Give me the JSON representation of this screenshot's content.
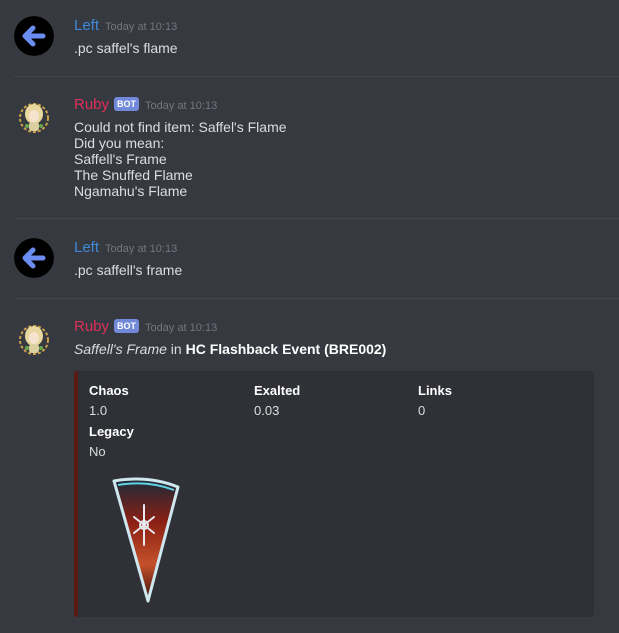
{
  "messages": [
    {
      "author": "Left",
      "timestamp": "Today at 10:13",
      "lines": [
        ".pc saffel's flame"
      ]
    },
    {
      "author": "Ruby",
      "bot_tag": "BOT",
      "timestamp": "Today at 10:13",
      "lines": [
        "Could not find item: Saffel's Flame",
        "Did you mean:",
        "Saffell's Frame",
        "The Snuffed Flame",
        "Ngamahu's Flame"
      ]
    },
    {
      "author": "Left",
      "timestamp": "Today at 10:13",
      "lines": [
        ".pc saffell's frame"
      ]
    },
    {
      "author": "Ruby",
      "bot_tag": "BOT",
      "timestamp": "Today at 10:13",
      "result": {
        "item": "Saffell's Frame",
        "connector": " in ",
        "league": "HC Flashback Event (BRE002)"
      },
      "embed": {
        "fields": [
          {
            "name": "Chaos",
            "value": "1.0"
          },
          {
            "name": "Exalted",
            "value": "0.03"
          },
          {
            "name": "Links",
            "value": "0"
          },
          {
            "name": "Legacy",
            "value": "No"
          }
        ],
        "thumbnail_icon": "shield-item-icon",
        "accent_color": "#5a1a12"
      }
    }
  ],
  "colors": {
    "background": "#36393f",
    "embed_bg": "#2f3136",
    "left_name": "#3e89d6",
    "ruby_name": "#e02f5a",
    "bot_badge": "#7289da"
  }
}
